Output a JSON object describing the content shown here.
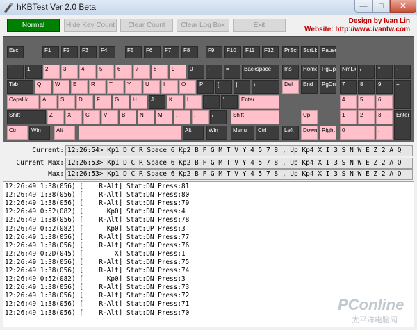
{
  "window": {
    "title": "hKBTest Ver 2.0 Beta"
  },
  "titlebar": {
    "minimize_glyph": "—",
    "maximize_glyph": "□",
    "close_glyph": "✕",
    "icon": "app-icon"
  },
  "toolbar": {
    "buttons": [
      {
        "label": "Normal",
        "state": "active"
      },
      {
        "label": "Hide Key Count",
        "state": "disabled"
      },
      {
        "label": "Clear Count",
        "state": "disabled"
      },
      {
        "label": "Clear Log Box",
        "state": "disabled"
      },
      {
        "label": "Exit",
        "state": "disabled"
      }
    ],
    "design_by": "Design by Ivan Lin",
    "website": "Website: http://www.ivantw.com"
  },
  "keyboard": {
    "colors": {
      "idle": "#3c3c3c",
      "pressed": "#ffc0cb",
      "panel": "#646464"
    },
    "keys": [
      {
        "label": "Esc",
        "pressed": false
      },
      {
        "label": "F1",
        "pressed": false
      },
      {
        "label": "F2",
        "pressed": false
      },
      {
        "label": "F3",
        "pressed": false
      },
      {
        "label": "F4",
        "pressed": false
      },
      {
        "label": "F5",
        "pressed": false
      },
      {
        "label": "F6",
        "pressed": false
      },
      {
        "label": "F7",
        "pressed": false
      },
      {
        "label": "F8",
        "pressed": false
      },
      {
        "label": "F9",
        "pressed": false
      },
      {
        "label": "F10",
        "pressed": false
      },
      {
        "label": "F11",
        "pressed": false
      },
      {
        "label": "F12",
        "pressed": false
      },
      {
        "label": "PrScr",
        "pressed": false
      },
      {
        "label": "ScrLk",
        "pressed": false
      },
      {
        "label": "Pause",
        "pressed": false
      },
      {
        "label": "`",
        "pressed": false
      },
      {
        "label": "1",
        "pressed": false
      },
      {
        "label": "2",
        "pressed": true
      },
      {
        "label": "3",
        "pressed": true
      },
      {
        "label": "4",
        "pressed": true
      },
      {
        "label": "5",
        "pressed": true
      },
      {
        "label": "6",
        "pressed": true
      },
      {
        "label": "7",
        "pressed": true
      },
      {
        "label": "8",
        "pressed": true
      },
      {
        "label": "9",
        "pressed": true
      },
      {
        "label": "0",
        "pressed": false
      },
      {
        "label": "-",
        "pressed": false
      },
      {
        "label": "=",
        "pressed": false
      },
      {
        "label": "Backspace",
        "pressed": false
      },
      {
        "label": "Ins",
        "pressed": false
      },
      {
        "label": "Home",
        "pressed": false
      },
      {
        "label": "PgUp",
        "pressed": false
      },
      {
        "label": "NmLk",
        "pressed": false
      },
      {
        "label": "/",
        "pressed": false
      },
      {
        "label": "*",
        "pressed": false
      },
      {
        "label": "-",
        "pressed": false
      },
      {
        "label": "Tab",
        "pressed": false
      },
      {
        "label": "Q",
        "pressed": true
      },
      {
        "label": "W",
        "pressed": true
      },
      {
        "label": "E",
        "pressed": true
      },
      {
        "label": "R",
        "pressed": true
      },
      {
        "label": "T",
        "pressed": true
      },
      {
        "label": "Y",
        "pressed": true
      },
      {
        "label": "U",
        "pressed": true
      },
      {
        "label": "I",
        "pressed": true
      },
      {
        "label": "O",
        "pressed": true
      },
      {
        "label": "P",
        "pressed": false
      },
      {
        "label": "[",
        "pressed": false
      },
      {
        "label": "]",
        "pressed": false
      },
      {
        "label": "\\",
        "pressed": false
      },
      {
        "label": "Del",
        "pressed": true
      },
      {
        "label": "End",
        "pressed": false
      },
      {
        "label": "PgDn",
        "pressed": false
      },
      {
        "label": "7",
        "pressed": false
      },
      {
        "label": "8",
        "pressed": false
      },
      {
        "label": "9",
        "pressed": false
      },
      {
        "label": "+",
        "pressed": false
      },
      {
        "label": "CapsLk",
        "pressed": true
      },
      {
        "label": "A",
        "pressed": true
      },
      {
        "label": "S",
        "pressed": true
      },
      {
        "label": "D",
        "pressed": true
      },
      {
        "label": "F",
        "pressed": true
      },
      {
        "label": "G",
        "pressed": true
      },
      {
        "label": "H",
        "pressed": true
      },
      {
        "label": "J",
        "pressed": false
      },
      {
        "label": "K",
        "pressed": true
      },
      {
        "label": "L",
        "pressed": true
      },
      {
        "label": ";",
        "pressed": false
      },
      {
        "label": "'",
        "pressed": false
      },
      {
        "label": "Enter",
        "pressed": true
      },
      {
        "label": "4",
        "pressed": true
      },
      {
        "label": "5",
        "pressed": true
      },
      {
        "label": "6",
        "pressed": true
      },
      {
        "label": "Shift",
        "pressed": false
      },
      {
        "label": "Z",
        "pressed": true
      },
      {
        "label": "X",
        "pressed": true
      },
      {
        "label": "C",
        "pressed": true
      },
      {
        "label": "V",
        "pressed": true
      },
      {
        "label": "B",
        "pressed": true
      },
      {
        "label": "N",
        "pressed": true
      },
      {
        "label": "M",
        "pressed": true
      },
      {
        "label": ",",
        "pressed": true
      },
      {
        "label": ".",
        "pressed": true
      },
      {
        "label": "/",
        "pressed": false
      },
      {
        "label": "Shift",
        "pressed": true
      },
      {
        "label": "Up",
        "pressed": true
      },
      {
        "label": "1",
        "pressed": true
      },
      {
        "label": "2",
        "pressed": true
      },
      {
        "label": "3",
        "pressed": true
      },
      {
        "label": "Enter",
        "pressed": false
      },
      {
        "label": "Ctrl",
        "pressed": true
      },
      {
        "label": "Win",
        "pressed": false
      },
      {
        "label": "Alt",
        "pressed": true
      },
      {
        "label": "",
        "pressed": true
      },
      {
        "label": "Alt",
        "pressed": false
      },
      {
        "label": "Win",
        "pressed": false
      },
      {
        "label": "Menu",
        "pressed": false
      },
      {
        "label": "Ctrl",
        "pressed": false
      },
      {
        "label": "Left",
        "pressed": false
      },
      {
        "label": "Down",
        "pressed": true
      },
      {
        "label": "Right",
        "pressed": true
      },
      {
        "label": "0",
        "pressed": true
      },
      {
        "label": ".",
        "pressed": true
      }
    ]
  },
  "status": {
    "current_label": "Current:",
    "current_value": "12:26:54> Kp1 D C R Space 6 Kp2 B F G M T V Y 4 5 7 8 , Up Kp4 X I 3 S N W E Z 2 A Q",
    "current_max_label": "Current Max:",
    "current_max_value": "12:26:53> Kp1 D C R Space 6 Kp2 B F G M T V Y 4 5 7 8 , Up Kp4 X I 3 S N W E Z 2 A Q",
    "max_label": "Max:",
    "max_value": "12:26:53> Kp1 D C R Space 6 Kp2 B F G M T V Y 4 5 7 8 , Up Kp4 X I 3 S N W E Z 2 A Q"
  },
  "log": {
    "lines": [
      "12:26:49 1:38(056) [    R-Alt] Stat:DN Press:81",
      "12:26:49 1:38(056) [    R-Alt] Stat:DN Press:80",
      "12:26:49 1:38(056) [    R-Alt] Stat:DN Press:79",
      "12:26:49 0:52(082) [      Kp0] Stat:DN Press:4",
      "12:26:49 1:38(056) [    R-Alt] Stat:DN Press:78",
      "12:26:49 0:52(082) [      Kp0] Stat:UP Press:3",
      "12:26:49 1:38(056) [    R-Alt] Stat:DN Press:77",
      "12:26:49 1:38(056) [    R-Alt] Stat:DN Press:76",
      "12:26:49 0:2D(045) [        X] Stat:DN Press:1",
      "12:26:49 1:38(056) [    R-Alt] Stat:DN Press:75",
      "12:26:49 1:38(056) [    R-Alt] Stat:DN Press:74",
      "12:26:49 0:52(082) [      Kp0] Stat:DN Press:3",
      "12:26:49 1:38(056) [    R-Alt] Stat:DN Press:73",
      "12:26:49 1:38(056) [    R-Alt] Stat:DN Press:72",
      "12:26:49 1:38(056) [    R-Alt] Stat:DN Press:71",
      "12:26:49 1:38(056) [    R-Alt] Stat:DN Press:70"
    ]
  },
  "watermark": {
    "text": "PConline",
    "subtext": "太平洋电脑网",
    "color": "#c0c8d0"
  }
}
